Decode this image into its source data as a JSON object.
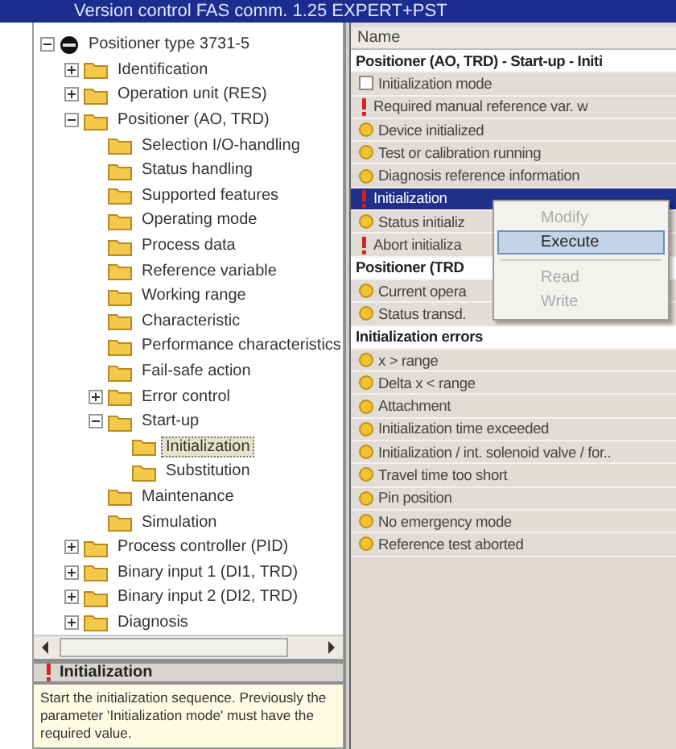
{
  "window": {
    "title": "Version control FAS  comm. 1.25  EXPERT+PST"
  },
  "tree": {
    "items": [
      {
        "label": "Positioner type 3731-5",
        "kind": "device",
        "expanded": true,
        "selected": false,
        "children": [
          {
            "label": "Identification",
            "kind": "folder",
            "expanded": false,
            "selected": false
          },
          {
            "label": "Operation unit (RES)",
            "kind": "folder",
            "expanded": false,
            "selected": false
          },
          {
            "label": "Positioner (AO, TRD)",
            "kind": "folder",
            "expanded": true,
            "selected": false,
            "children": [
              {
                "label": "Selection I/O-handling",
                "kind": "folder",
                "selected": false
              },
              {
                "label": "Status handling",
                "kind": "folder",
                "selected": false
              },
              {
                "label": "Supported features",
                "kind": "folder",
                "selected": false
              },
              {
                "label": "Operating mode",
                "kind": "folder",
                "selected": false
              },
              {
                "label": "Process data",
                "kind": "folder",
                "selected": false
              },
              {
                "label": "Reference variable",
                "kind": "folder",
                "selected": false
              },
              {
                "label": "Working range",
                "kind": "folder",
                "selected": false
              },
              {
                "label": "Characteristic",
                "kind": "folder",
                "selected": false
              },
              {
                "label": "Performance characteristics",
                "kind": "folder",
                "selected": false
              },
              {
                "label": "Fail-safe action",
                "kind": "folder",
                "selected": false
              },
              {
                "label": "Error control",
                "kind": "folder",
                "expanded": false,
                "selected": false
              },
              {
                "label": "Start-up",
                "kind": "folder",
                "expanded": true,
                "selected": false,
                "children": [
                  {
                    "label": "Initialization",
                    "kind": "folder",
                    "selected": true
                  },
                  {
                    "label": "Substitution",
                    "kind": "folder",
                    "selected": false
                  }
                ]
              },
              {
                "label": "Maintenance",
                "kind": "folder",
                "selected": false
              },
              {
                "label": "Simulation",
                "kind": "folder",
                "selected": false
              }
            ]
          },
          {
            "label": "Process controller (PID)",
            "kind": "folder",
            "expanded": false,
            "selected": false
          },
          {
            "label": "Binary input 1 (DI1, TRD)",
            "kind": "folder",
            "expanded": false,
            "selected": false
          },
          {
            "label": "Binary input 2 (DI2, TRD)",
            "kind": "folder",
            "expanded": false,
            "selected": false
          },
          {
            "label": "Diagnosis",
            "kind": "folder",
            "expanded": false,
            "selected": false
          }
        ]
      }
    ]
  },
  "info": {
    "title": "Initialization",
    "text": "Start the initialization sequence. Previously the parameter 'Initialization mode' must have the required value."
  },
  "list": {
    "column": "Name",
    "rows": [
      {
        "kind": "group",
        "label": "Positioner (AO, TRD) - Start-up - Initi",
        "selected": false
      },
      {
        "kind": "checkbox",
        "label": "Initialization mode",
        "selected": false
      },
      {
        "kind": "alert",
        "label": "Required manual reference var. w",
        "selected": false
      },
      {
        "kind": "bulb",
        "label": "Device initialized",
        "selected": false
      },
      {
        "kind": "bulb",
        "label": "Test or calibration running",
        "selected": false
      },
      {
        "kind": "bulb",
        "label": "Diagnosis reference information",
        "selected": false
      },
      {
        "kind": "alert",
        "label": "Initialization",
        "selected": true
      },
      {
        "kind": "bulb",
        "label": "Status initializ",
        "selected": false
      },
      {
        "kind": "alert",
        "label": "Abort initializa",
        "selected": false
      },
      {
        "kind": "group",
        "label": "Positioner (TRD",
        "selected": false
      },
      {
        "kind": "bulb",
        "label": "Current opera",
        "selected": false
      },
      {
        "kind": "bulb",
        "label": "Status transd.",
        "selected": false
      },
      {
        "kind": "group",
        "label": "Initialization errors",
        "selected": false
      },
      {
        "kind": "bulb",
        "label": "x > range",
        "selected": false
      },
      {
        "kind": "bulb",
        "label": "Delta x < range",
        "selected": false
      },
      {
        "kind": "bulb",
        "label": "Attachment",
        "selected": false
      },
      {
        "kind": "bulb",
        "label": "Initialization time exceeded",
        "selected": false
      },
      {
        "kind": "bulb",
        "label": "Initialization / int. solenoid valve / for..",
        "selected": false
      },
      {
        "kind": "bulb",
        "label": "Travel time too short",
        "selected": false
      },
      {
        "kind": "bulb",
        "label": "Pin position",
        "selected": false
      },
      {
        "kind": "bulb",
        "label": "No emergency mode",
        "selected": false
      },
      {
        "kind": "bulb",
        "label": "Reference test aborted",
        "selected": false
      }
    ]
  },
  "context_menu": {
    "items": [
      {
        "label": "Modify",
        "disabled": true,
        "selected": false
      },
      {
        "label": "Execute",
        "disabled": false,
        "selected": true
      },
      {
        "label": "Read",
        "disabled": true,
        "selected": false
      },
      {
        "label": "Write",
        "disabled": true,
        "selected": false
      }
    ]
  }
}
